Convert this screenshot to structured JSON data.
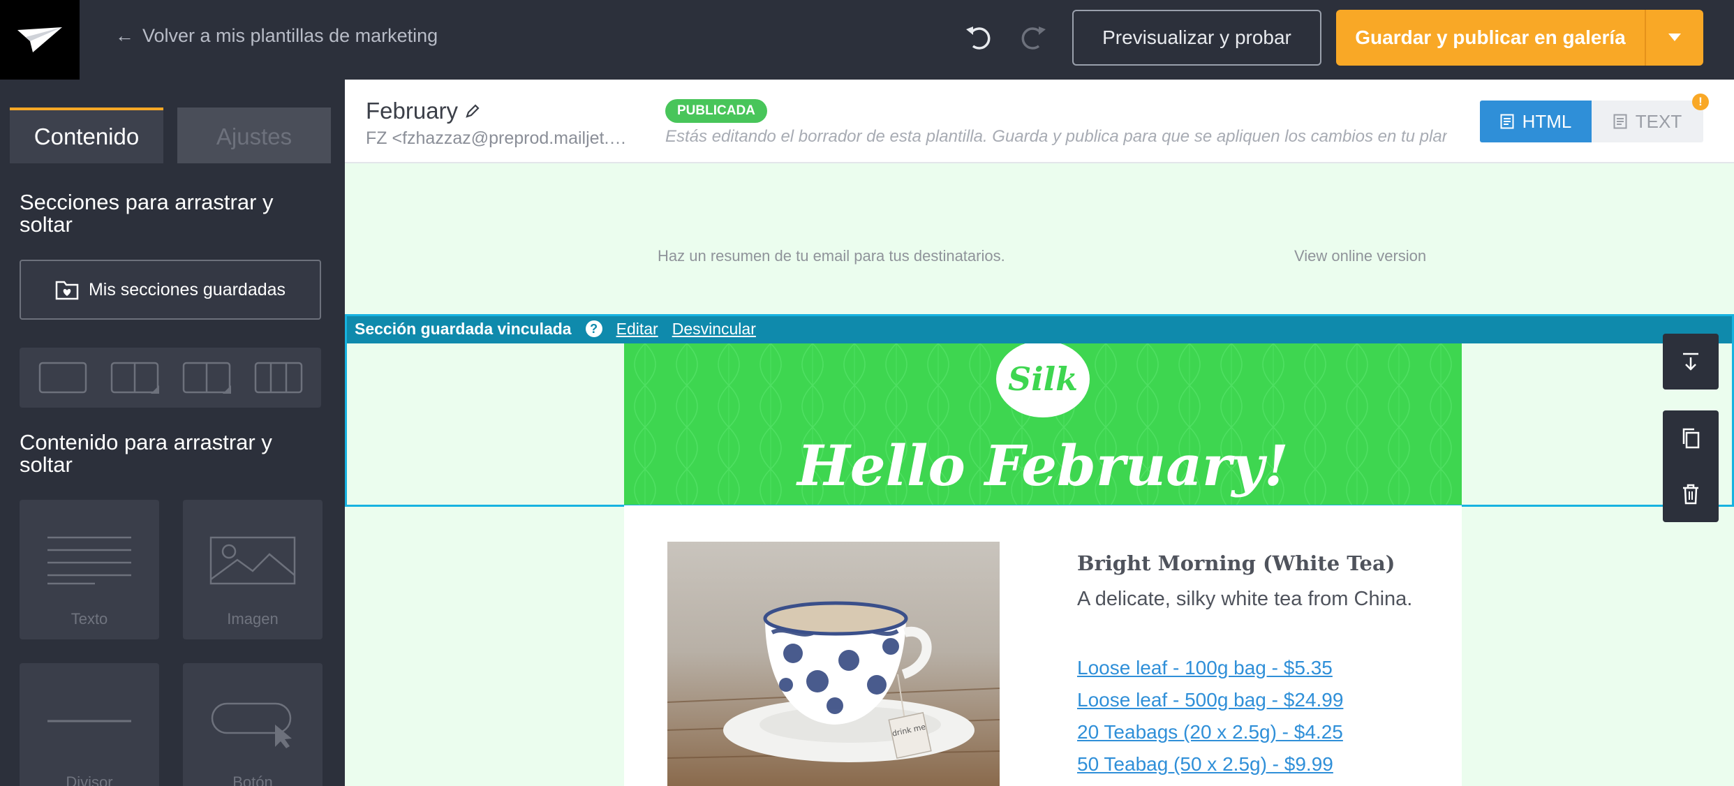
{
  "topbar": {
    "back_label": "Volver a mis plantillas de marketing",
    "preview_label": "Previsualizar y probar",
    "publish_label": "Guardar y publicar en galería"
  },
  "sidebar": {
    "tabs": [
      {
        "label": "Contenido"
      },
      {
        "label": "Ajustes"
      }
    ],
    "sections_heading": "Secciones para arrastrar y soltar",
    "saved_sections_label": "Mis secciones guardadas",
    "content_heading": "Contenido para arrastrar y soltar",
    "blocks": [
      {
        "label": "Texto",
        "icon": "text-block-icon"
      },
      {
        "label": "Imagen",
        "icon": "image-block-icon"
      },
      {
        "label": "Divisor",
        "icon": "divider-block-icon"
      },
      {
        "label": "Botón",
        "icon": "button-block-icon"
      }
    ]
  },
  "editor": {
    "template_name": "February",
    "from": "FZ <fzhazzaz@preprod.mailjet.com>",
    "status_badge": "PUBLICADA",
    "draft_note": "Estás editando el borrador de esta plantilla. Guarda y publica para que se apliquen los cambios en tu plantilla.",
    "mode_html": "HTML",
    "mode_text": "TEXT",
    "warning": "!"
  },
  "email": {
    "preheader": "Haz un resumen de tu email para tus destinatarios.",
    "online_version": "View online version",
    "linked_section": {
      "title": "Sección guardada vinculada",
      "help": "?",
      "edit_label": "Editar",
      "unlink_label": "Desvincular"
    },
    "hero": {
      "logo_text": "Silk",
      "title": "Hello February!"
    },
    "product": {
      "title": "Bright Morning (White Tea)",
      "description": "A delicate, silky white tea from China.",
      "tag_text": "drink me",
      "links": [
        "Loose leaf - 100g bag - $5.35",
        "Loose leaf - 500g bag - $24.99",
        "20 Teabags (20 x 2.5g) - $4.25",
        "50 Teabag (50 x 2.5g) - $9.99"
      ]
    }
  },
  "colors": {
    "topbar": "#2c303b",
    "accent": "#f9a826",
    "primary_blue": "#2f8fd8",
    "hero_green": "#3ed650",
    "linked_bar": "#0f8aac"
  }
}
